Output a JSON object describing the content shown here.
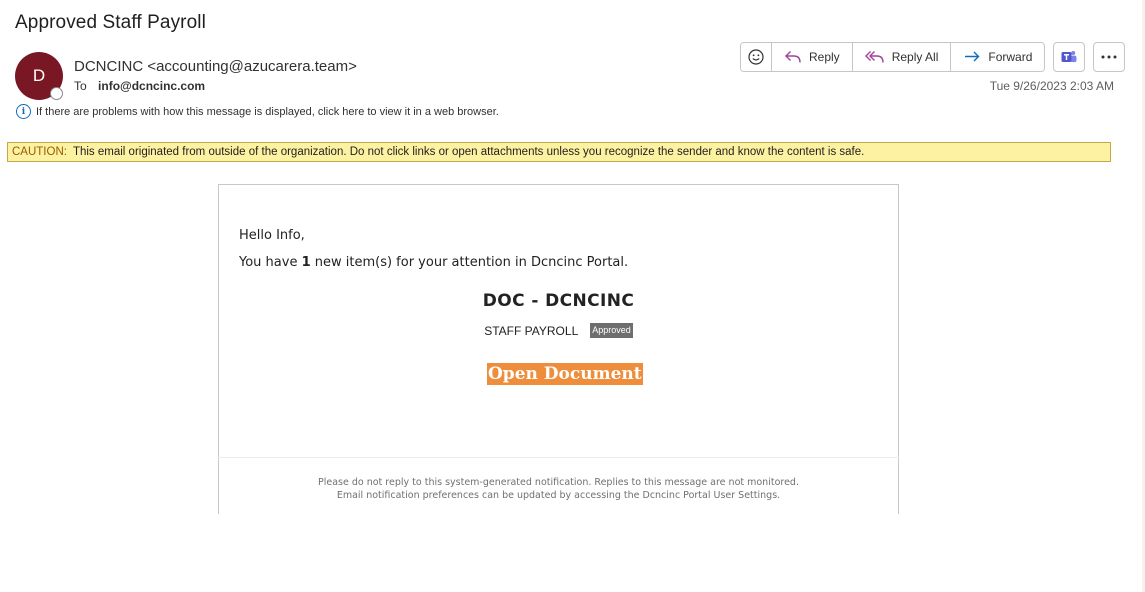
{
  "header": {
    "subject": "Approved Staff Payroll",
    "avatar_initial": "D",
    "avatar_color": "#7a1725",
    "sender": "DCNCINC <accounting@azucarera.team>",
    "to_label": "To",
    "to_address": "info@dcncinc.com",
    "date": "Tue 9/26/2023 2:03 AM",
    "info_text": "If there are problems with how this message is displayed, click here to view it in a web browser."
  },
  "toolbar": {
    "emoji_icon": "smiley-icon",
    "reply_label": "Reply",
    "reply_all_label": "Reply All",
    "forward_label": "Forward",
    "teams_icon": "teams-icon",
    "more_icon": "more-icon"
  },
  "caution": {
    "label": "CAUTION:",
    "text": "This email originated from outside of the organization. Do not click links or open attachments unless you recognize the sender and know the content is safe.",
    "background": "#fdf2a1"
  },
  "message": {
    "greeting": "Hello Info,",
    "notice_prefix": "You have ",
    "notice_count": "1",
    "notice_suffix": " new item(s) for your attention in Dcncinc Portal.",
    "doc_title": "DOC - DCNCINC",
    "doc_subtitle": "STAFF PAYROLL",
    "status_badge": "Approved",
    "open_button": "Open Document",
    "open_button_color": "#ee8e3d",
    "footer_line1": "Please do not reply to this system-generated notification. Replies to this message are not monitored.",
    "footer_line2": "Email notification preferences can be updated by accessing the Dcncinc Portal User Settings."
  }
}
